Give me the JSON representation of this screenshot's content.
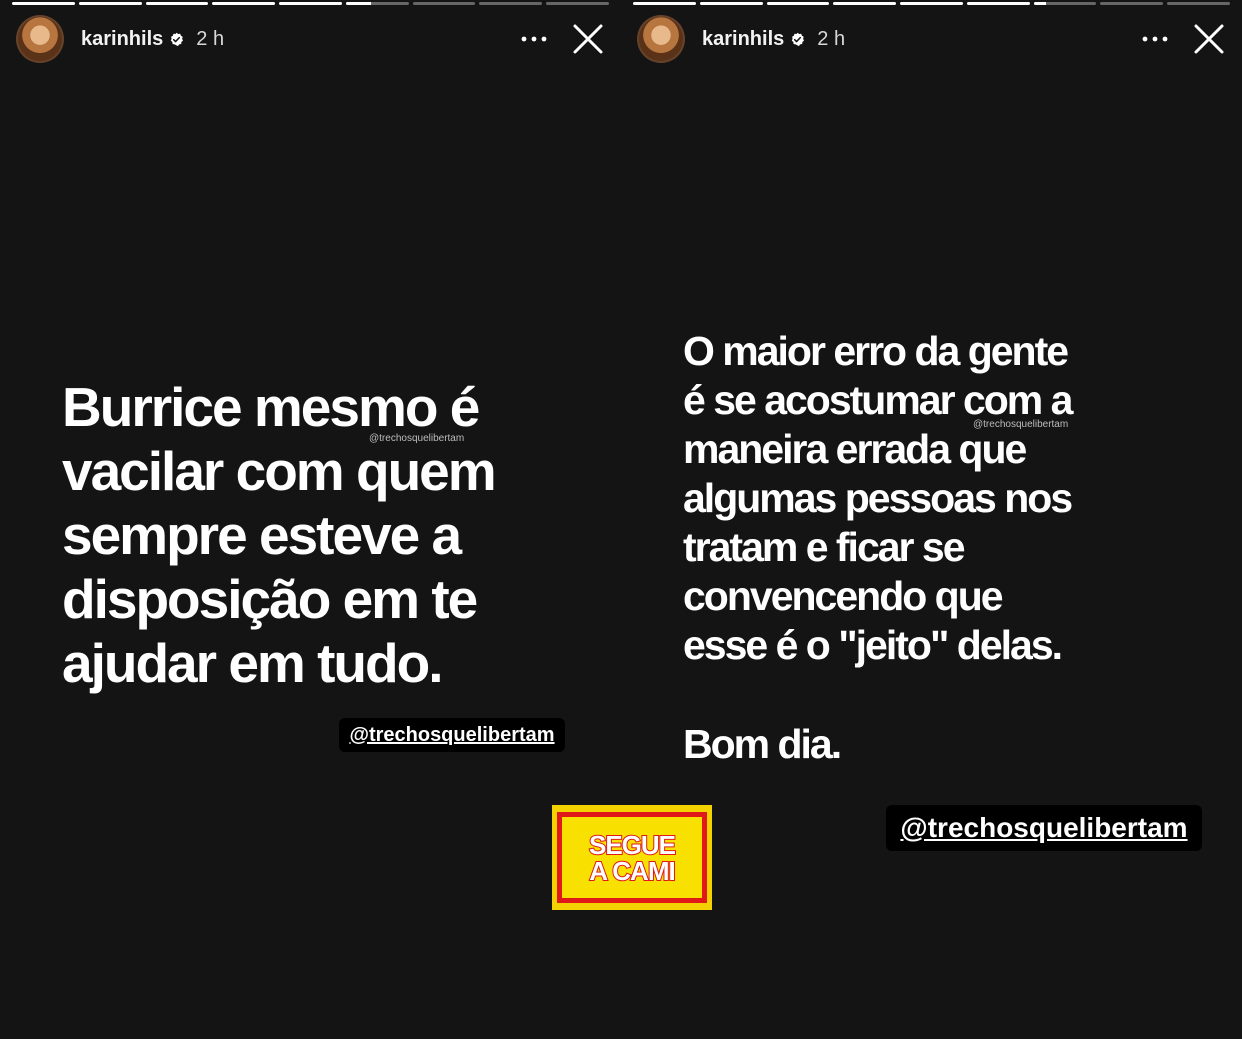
{
  "stories": [
    {
      "progress": [
        1,
        1,
        1,
        1,
        1,
        0.4,
        0,
        0,
        0
      ],
      "username": "karinhils",
      "time": "2 h",
      "quote": "Burrice mesmo é\nvacilar com quem\nsempre esteve a\ndisposição em te\najudar em tudo.",
      "watermark": "@trechosquelibertam",
      "mention": "@trechosquelibertam"
    },
    {
      "progress": [
        1,
        1,
        1,
        1,
        1,
        1,
        0.2,
        0,
        0
      ],
      "username": "karinhils",
      "time": "2 h",
      "quote": "O maior erro da gente\né se acostumar com a\nmaneira errada que\nalgumas pessoas nos\ntratam e ficar se\nconvencendo que\nesse é o \"jeito\" delas.",
      "closing": "Bom dia.",
      "watermark": "@trechosquelibertam",
      "mention": "@trechosquelibertam"
    }
  ],
  "sticker": {
    "line1": "SEGUE",
    "line2": "A CAMI"
  },
  "icons": {
    "verified": "verified-badge-icon",
    "more": "more-options-icon",
    "close": "close-icon"
  },
  "colors": {
    "background": "#141414",
    "mention_bg": "#000000",
    "sticker_yellow": "#f3d200",
    "sticker_red": "#e01818"
  }
}
